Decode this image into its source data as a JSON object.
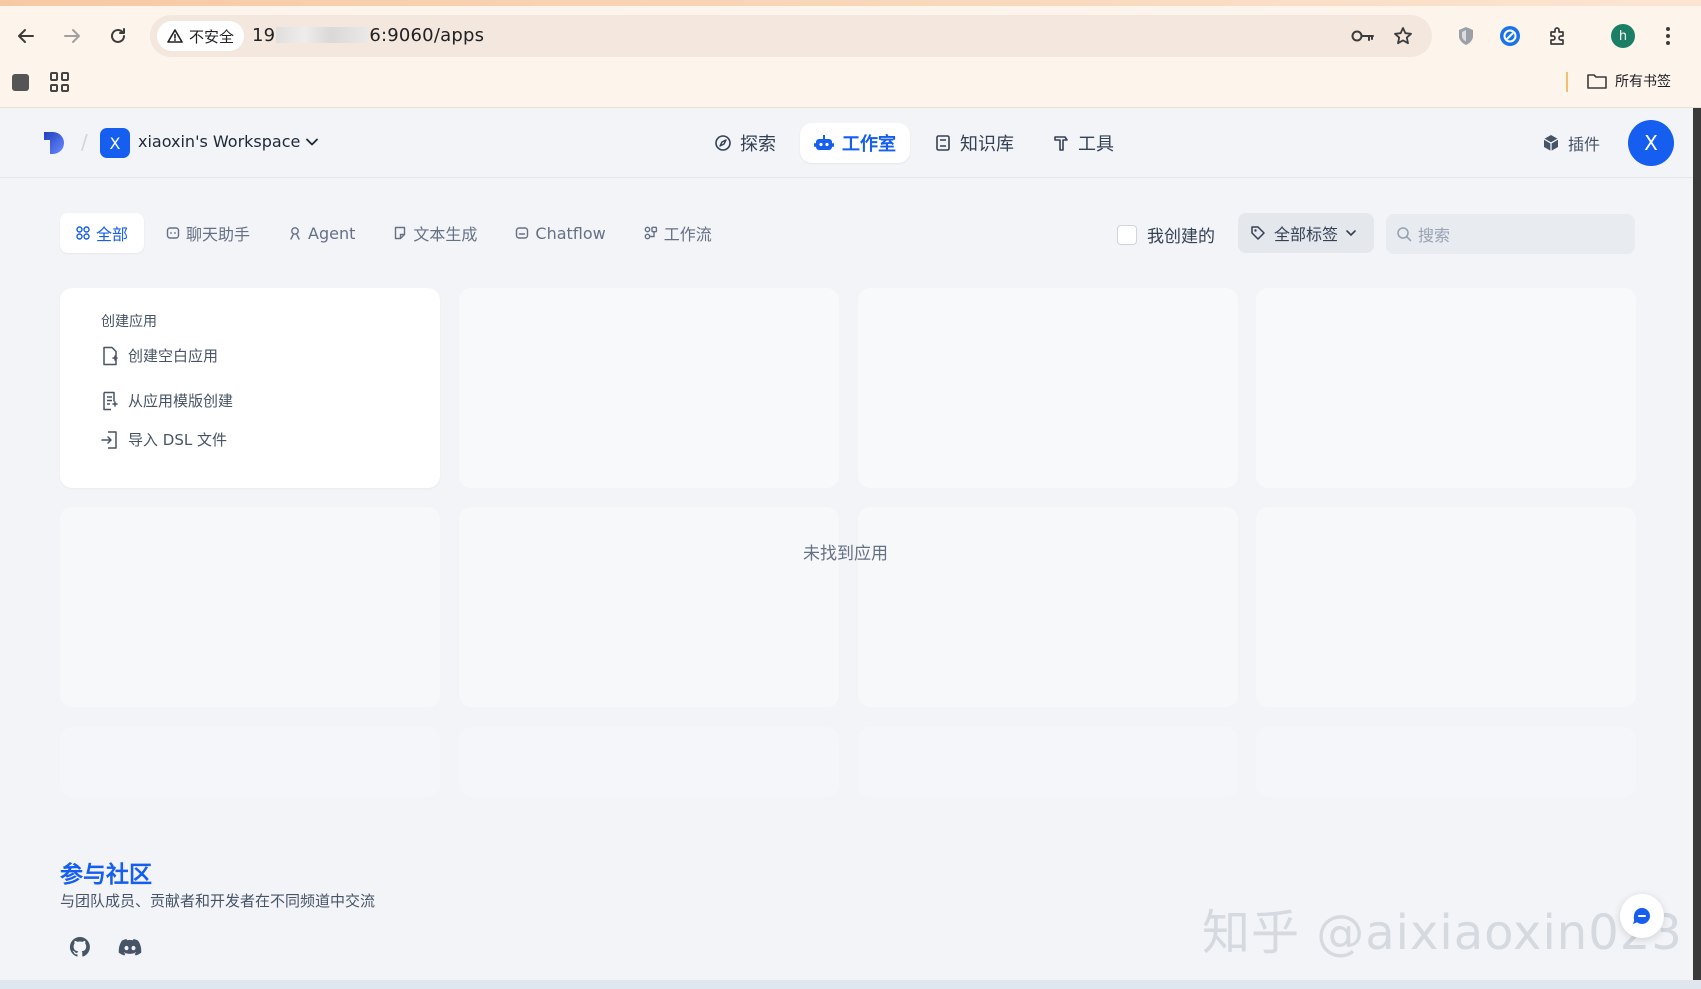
{
  "browser": {
    "address": {
      "security_label": "不安全",
      "url_prefix": "19",
      "url_suffix": "6:9060/apps"
    },
    "bookmarks": {
      "all_bookmarks_label": "所有书签"
    },
    "profile_initial": "h"
  },
  "header": {
    "workspace_initial": "X",
    "workspace_name": "xiaoxin's Workspace",
    "nav": [
      {
        "label": "探索",
        "icon": "compass-icon"
      },
      {
        "label": "工作室",
        "icon": "robot-icon",
        "active": true
      },
      {
        "label": "知识库",
        "icon": "book-icon"
      },
      {
        "label": "工具",
        "icon": "hammer-icon"
      }
    ],
    "plugin_label": "插件",
    "user_initial": "X"
  },
  "filters": {
    "tabs": [
      {
        "label": "全部",
        "icon": "grid-icon",
        "active": true
      },
      {
        "label": "聊天助手",
        "icon": "chat-icon"
      },
      {
        "label": "Agent",
        "icon": "agent-icon"
      },
      {
        "label": "文本生成",
        "icon": "doc-icon"
      },
      {
        "label": "Chatflow",
        "icon": "chatflow-icon"
      },
      {
        "label": "工作流",
        "icon": "workflow-icon"
      }
    ],
    "mine_label": "我创建的",
    "tag_select_label": "全部标签",
    "search_placeholder": "搜索"
  },
  "create": {
    "title": "创建应用",
    "items": [
      {
        "label": "创建空白应用",
        "icon": "file-plus-icon"
      },
      {
        "label": "从应用模版创建",
        "icon": "template-icon"
      },
      {
        "label": "导入 DSL 文件",
        "icon": "import-icon"
      }
    ]
  },
  "empty_state": "未找到应用",
  "community": {
    "title": "参与社区",
    "subtitle": "与团队成员、贡献者和开发者在不同频道中交流"
  },
  "watermark": "知乎 @aixiaoxin023",
  "colors": {
    "accent": "#155eef",
    "page_bg": "#f2f4f7"
  }
}
